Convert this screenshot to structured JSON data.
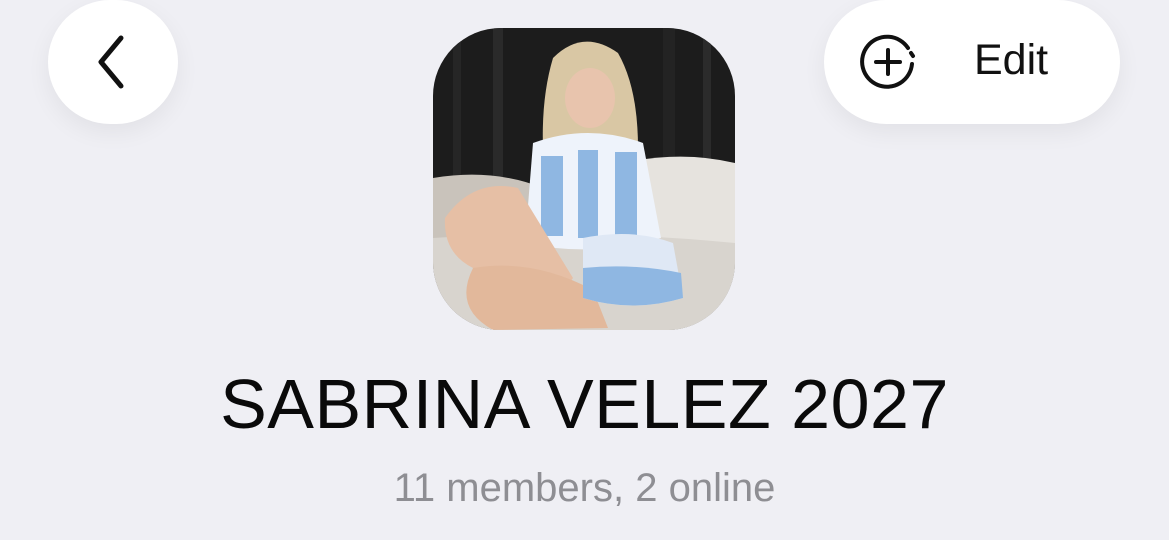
{
  "header": {
    "back_icon": "chevron-left-icon",
    "add_icon": "add-member-dashed-circle-icon",
    "edit_label": "Edit"
  },
  "group": {
    "photo": "group-avatar-photo",
    "name": "SABRINA VELEZ 2027",
    "meta": "11 members, 2 online"
  }
}
